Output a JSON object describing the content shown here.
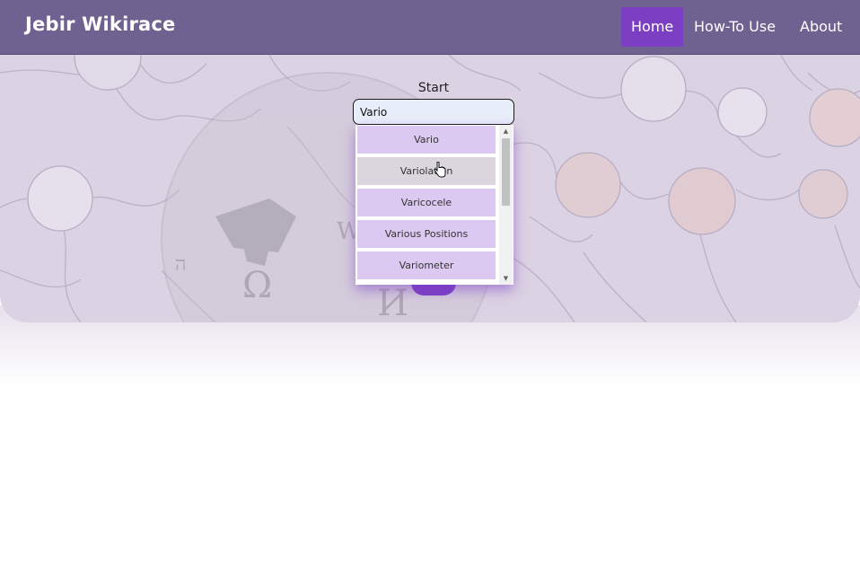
{
  "navbar": {
    "brand": "Jebir Wikirace",
    "links": [
      {
        "label": "Home",
        "active": true
      },
      {
        "label": "How-To Use",
        "active": false
      },
      {
        "label": "About",
        "active": false
      }
    ]
  },
  "form": {
    "start_label": "Start",
    "start_value": "Vario"
  },
  "suggestions": [
    "Vario",
    "Variolation",
    "Varicocele",
    "Various Positions",
    "Variometer"
  ],
  "colors": {
    "navbar": "#6f6190",
    "accent": "#7c3fc4",
    "hero": "#dbd2e3",
    "suggestion": "#dcc9f1",
    "suggestion_hover": "#dbd6de"
  },
  "icons": {
    "cursor": "hand-pointer-icon",
    "scroll_up": "scroll-up-arrow-icon",
    "scroll_down": "scroll-down-arrow-icon"
  }
}
